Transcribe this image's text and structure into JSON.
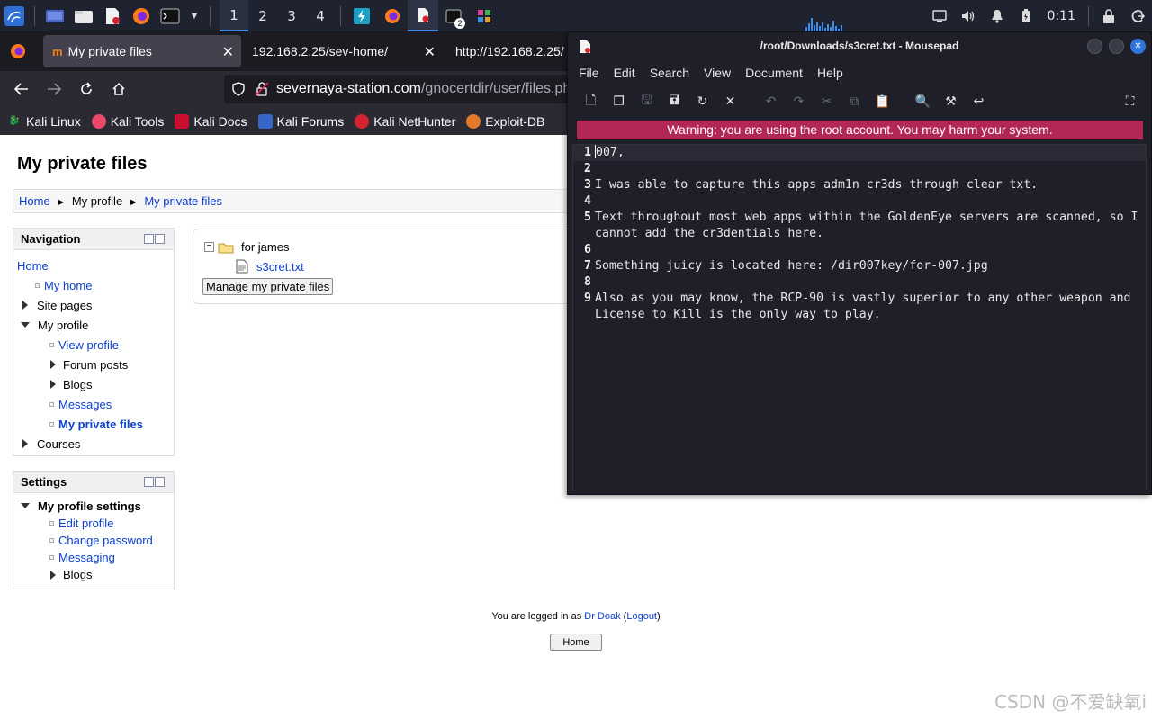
{
  "taskbar": {
    "workspaces": [
      "1",
      "2",
      "3",
      "4"
    ],
    "terminal_badge": "2",
    "clock": "0:11"
  },
  "browser": {
    "tabs": [
      {
        "title": "My private files",
        "active": true
      },
      {
        "title": "192.168.2.25/sev-home/",
        "active": false
      },
      {
        "title": "http://192.168.2.25/",
        "active": false
      }
    ],
    "url_host": "severnaya-station.com",
    "url_path": "/gnocertdir/user/files.ph",
    "bookmarks": [
      "Kali Linux",
      "Kali Tools",
      "Kali Docs",
      "Kali Forums",
      "Kali NetHunter",
      "Exploit-DB"
    ]
  },
  "page": {
    "title": "My private files",
    "breadcrumb": {
      "home": "Home",
      "sep": "►",
      "profile": "My profile",
      "current": "My private files"
    },
    "navigation": {
      "title": "Navigation",
      "home": "Home",
      "my_home": "My home",
      "site_pages": "Site pages",
      "my_profile": "My profile",
      "view_profile": "View profile",
      "forum_posts": "Forum posts",
      "blogs": "Blogs",
      "messages": "Messages",
      "my_private_files": "My private files",
      "courses": "Courses"
    },
    "settings": {
      "title": "Settings",
      "my_profile_settings": "My profile settings",
      "edit_profile": "Edit profile",
      "change_password": "Change password",
      "messaging": "Messaging",
      "blogs": "Blogs"
    },
    "files": {
      "folder": "for james",
      "file": "s3cret.txt",
      "manage_button": "Manage my private files"
    },
    "footer": {
      "logged_in_prefix": "You are logged in as ",
      "user": "Dr Doak",
      "logout": "Logout",
      "home_button": "Home"
    },
    "watermark": "CSDN @不爱缺氧i"
  },
  "mousepad": {
    "title": "/root/Downloads/s3cret.txt - Mousepad",
    "menu": [
      "File",
      "Edit",
      "Search",
      "View",
      "Document",
      "Help"
    ],
    "warning": "Warning: you are using the root account. You may harm your system.",
    "lines": [
      {
        "n": "1",
        "text": "007,"
      },
      {
        "n": "2",
        "text": ""
      },
      {
        "n": "3",
        "text": "I was able to capture this apps adm1n cr3ds through clear txt."
      },
      {
        "n": "4",
        "text": ""
      },
      {
        "n": "5",
        "text": "Text throughout most web apps within the GoldenEye servers are scanned, so I cannot add the cr3dentials here."
      },
      {
        "n": "6",
        "text": ""
      },
      {
        "n": "7",
        "text": "Something juicy is located here: /dir007key/for-007.jpg"
      },
      {
        "n": "8",
        "text": ""
      },
      {
        "n": "9",
        "text": "Also as you may know, the RCP-90 is vastly superior to any other weapon and License to Kill is the only way to play."
      }
    ]
  },
  "colors": {
    "panel_bg": "#1f2330",
    "accent": "#3d8ee8",
    "warning_bg": "#b32754",
    "link": "#0d40cc"
  }
}
